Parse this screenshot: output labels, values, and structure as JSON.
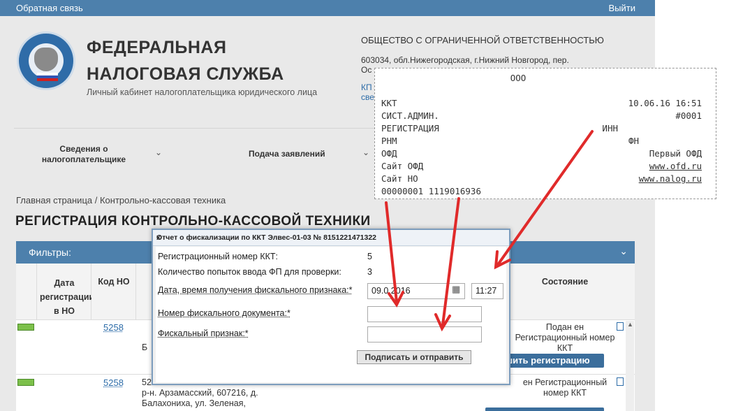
{
  "topbar": {
    "feedback": "Обратная связь",
    "exit": "Выйти"
  },
  "header": {
    "title_line1": "ФЕДЕРАЛЬНАЯ",
    "title_line2": "НАЛОГОВАЯ СЛУЖБА",
    "subtitle": "Личный кабинет налогоплательщика юридического лица",
    "org_name": "ОБЩЕСТВО С ОГРАНИЧЕННОЙ ОТВЕТСТВЕННОСТЬЮ",
    "org_address": "603034, обл.Нижегородская, г.Нижний Новгород, пер.",
    "org_address_cont": "Ос",
    "side_link_1": "КП",
    "side_link_2": "све"
  },
  "nav": {
    "item1": "Сведения о налогоплательщике",
    "item2": "Подача заявлений"
  },
  "breadcrumb": "Главная страница / Контрольно-кассовая техника",
  "page_title": "РЕГИСТРАЦИЯ КОНТРОЛЬНО-КАССОВОЙ ТЕХНИКИ",
  "filters": {
    "label": "Фильтры:"
  },
  "table": {
    "headers": {
      "reg_date": "Дата регистрации в НО",
      "code_no": "Код НО",
      "state": "Состояние"
    },
    "rows": [
      {
        "code": "5258",
        "addr": "Б",
        "status": "Подан ен Регистрационный номер ККТ",
        "button": "ошить регистрацию"
      },
      {
        "code": "5258",
        "addr_lines": [
          "52",
          "р-н. Арзамасский, 607216, д.",
          "Балахониха, ул. Зеленая,"
        ],
        "status": "ен Регистрационный номер ККТ"
      }
    ]
  },
  "modal": {
    "title": "Отчет о фискализации по ККТ Элвес-01-03 № 8151221471322",
    "close": "x",
    "reg_label": "Регистрационный номер ККТ:",
    "reg_value": "5",
    "attempts_label": "Количество попыток ввода ФП для проверки:",
    "attempts_value": "3",
    "datetime_label": "Дата, время получения фискального признака:*",
    "date_value": "09.0   2016",
    "time_value": "11:27",
    "docnum_label": "Номер фискального документа:*",
    "sign_label": "Фискальный признак:*",
    "submit": "Подписать и отправить"
  },
  "receipt": {
    "org": "ООО",
    "kkt_label": "ККТ",
    "kkt_datetime": "10.06.16 16:51",
    "sysadmin_label": "СИСТ.АДМИН.",
    "sysadmin_value": "#0001",
    "registration": "РЕГИСТРАЦИЯ",
    "inn": "ИНН",
    "rnm": "РНМ",
    "fn": "ФН",
    "ofd_label": "ОФД",
    "ofd_value": "Первый ОФД",
    "ofd_site_label": "Сайт ОФД",
    "ofd_site": "www.ofd.ru",
    "no_site_label": "Сайт НО",
    "no_site": "www.nalog.ru",
    "numbers": "00000001 1119016936"
  },
  "colors": {
    "accent": "#4d80ac",
    "arrow": "#e02a2a",
    "toggle": "#7cc04a"
  }
}
